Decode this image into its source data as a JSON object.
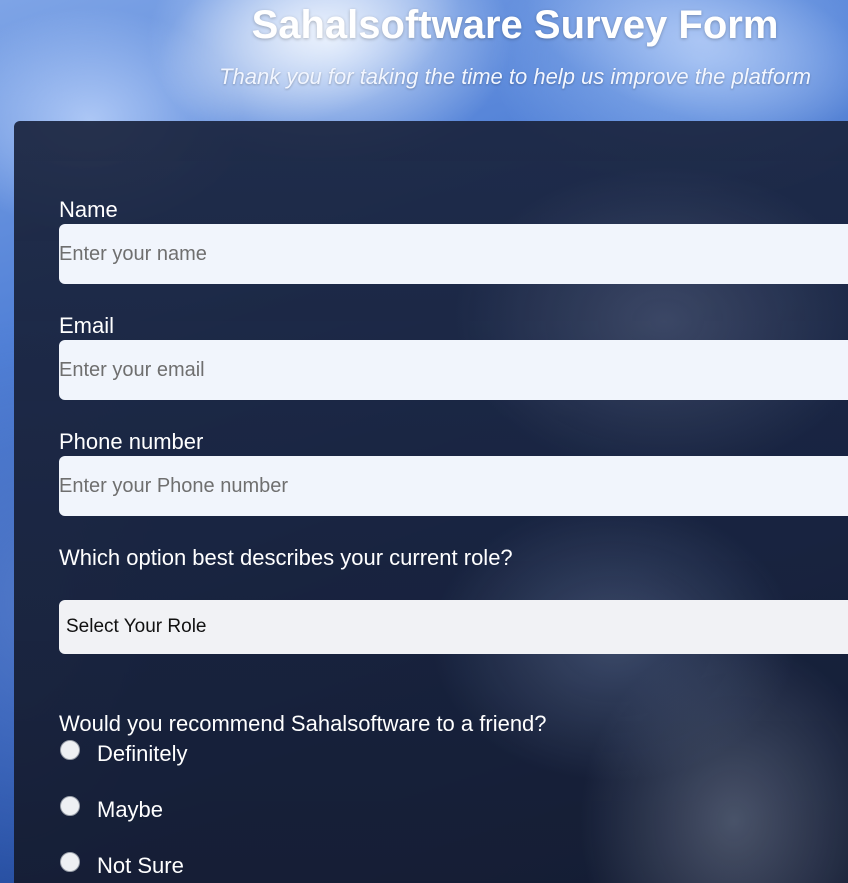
{
  "header": {
    "title": "Sahalsoftware Survey Form",
    "subtitle": "Thank you for taking the time to help us improve the platform"
  },
  "form": {
    "name": {
      "label": "Name",
      "placeholder": "Enter your name",
      "value": ""
    },
    "email": {
      "label": "Email",
      "placeholder": "Enter your email",
      "value": ""
    },
    "phone": {
      "label": "Phone number",
      "placeholder": "Enter your Phone number",
      "value": ""
    },
    "role": {
      "question": "Which option best describes your current role?",
      "selected": "Select Your Role"
    },
    "recommend": {
      "question": "Would you recommend Sahalsoftware to a friend?",
      "options": [
        {
          "label": "Definitely",
          "checked": false
        },
        {
          "label": "Maybe",
          "checked": false
        },
        {
          "label": "Not Sure",
          "checked": false
        }
      ]
    }
  },
  "colors": {
    "panel": "#1a243e",
    "input_bg": "#f1f5fc",
    "text": "#ffffff"
  }
}
